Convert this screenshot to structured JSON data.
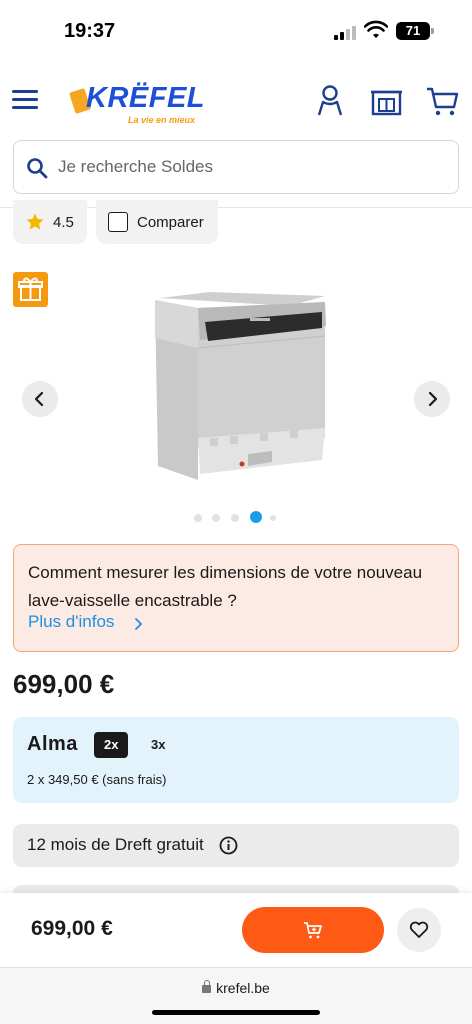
{
  "status_bar": {
    "time": "19:37",
    "battery": "71"
  },
  "header": {
    "logo_text": "KRËFEL",
    "logo_tagline": "La vie en mieux",
    "brand_color": "#1d4fd8",
    "icons": [
      "menu-icon",
      "account-icon",
      "store-icon",
      "cart-icon"
    ]
  },
  "search": {
    "placeholder": "Je recherche Soldes",
    "value": ""
  },
  "rating": {
    "value": "4.5",
    "icon": "star-icon",
    "color": "#f5b800"
  },
  "compare": {
    "label": "Comparer",
    "checked": false
  },
  "gallery": {
    "slide_count": 5,
    "active_slide": 4,
    "badge_icon": "gift-icon"
  },
  "info_box": {
    "text": "Comment mesurer les dimensions de votre nouveau lave-vaisselle encastrable ?",
    "link_label": "Plus d'infos"
  },
  "price": "699,00 €",
  "alma": {
    "logo": "Alma",
    "options": [
      "2x",
      "3x"
    ],
    "selected": "2x",
    "detail": "2 x 349,50 € (sans frais)"
  },
  "dreft": {
    "label": "12 mois de Dreft gratuit"
  },
  "sticky_bar": {
    "price": "699,00 €",
    "cart_color": "#fe5a16"
  },
  "browser": {
    "url": "krefel.be"
  }
}
